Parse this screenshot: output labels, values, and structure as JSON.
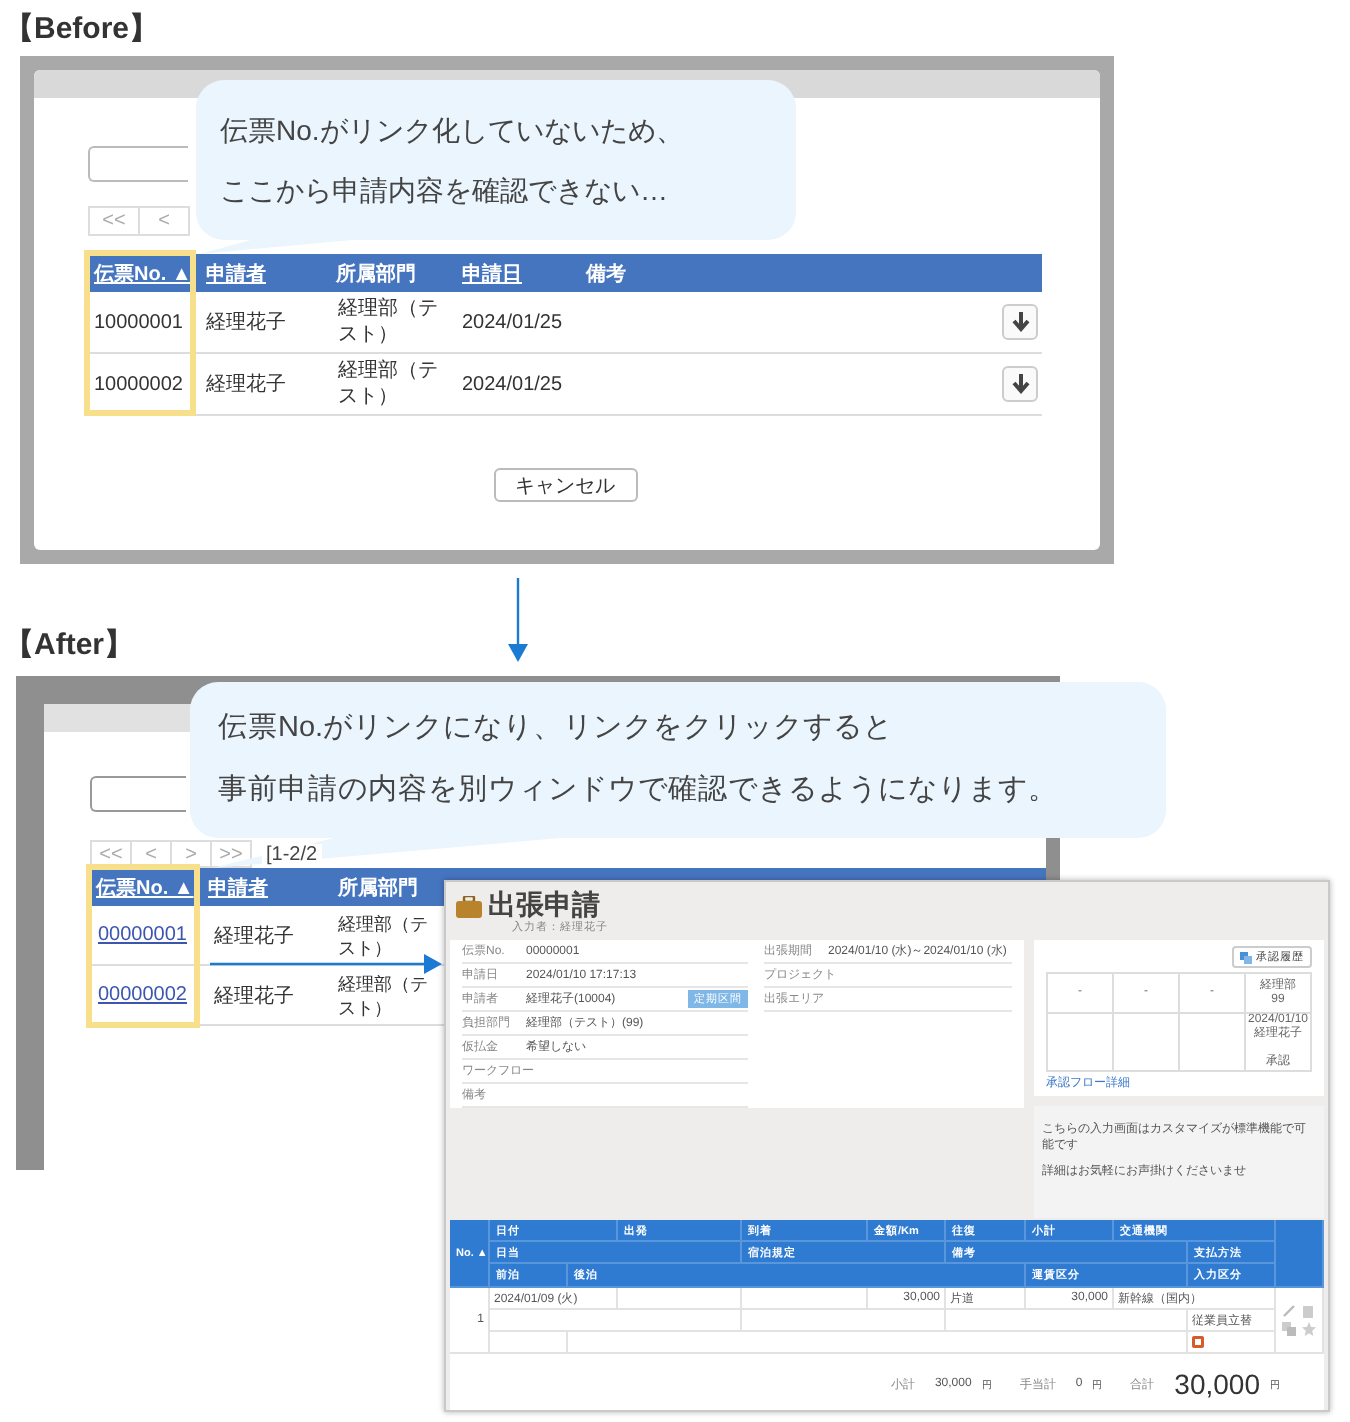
{
  "before": {
    "heading": "【Before】",
    "callout": [
      "伝票No.がリンク化していないため、",
      "ここから申請内容を確認できない…"
    ],
    "pager": [
      "<<",
      "<"
    ],
    "columns": [
      {
        "label": "伝票No. ▲",
        "sortable": true
      },
      {
        "label": "申請者",
        "sortable": true
      },
      {
        "label": "所属部門",
        "sortable": false
      },
      {
        "label": "申請日",
        "sortable": true
      },
      {
        "label": "備考",
        "sortable": false
      }
    ],
    "rows": [
      {
        "number": "10000001",
        "applicant": "経理花子",
        "department": "経理部（テスト）",
        "date": "2024/01/25"
      },
      {
        "number": "10000002",
        "applicant": "経理花子",
        "department": "経理部（テスト）",
        "date": "2024/01/25"
      }
    ],
    "cancel_button": "キャンセル"
  },
  "after": {
    "heading": "【After】",
    "callout": [
      "伝票No.がリンクになり、リンクをクリックすると",
      "事前申請の内容を別ウィンドウで確認できるようになります。"
    ],
    "pager": [
      "<<",
      "<",
      ">",
      ">>"
    ],
    "page_info": "[1-2/2",
    "columns": [
      {
        "label": "伝票No. ▲",
        "sortable": true
      },
      {
        "label": "申請者",
        "sortable": true
      },
      {
        "label": "所属部門",
        "sortable": false
      }
    ],
    "rows": [
      {
        "number": "00000001",
        "applicant": "経理花子",
        "department": "経理部（テスト）"
      },
      {
        "number": "00000002",
        "applicant": "経理花子",
        "department": "経理部（テスト）"
      }
    ]
  },
  "detail_window": {
    "title": "出張申請",
    "author": "入力者：経理花子",
    "fields": [
      {
        "label": "伝票No.",
        "value": "00000001"
      },
      {
        "label": "申請日",
        "value": "2024/01/10 17:17:13"
      },
      {
        "label": "申請者",
        "value": "経理花子(10004)",
        "button": "定期区間"
      },
      {
        "label": "負担部門",
        "value": "経理部（テスト）(99)"
      },
      {
        "label": "仮払金",
        "value": "希望しない"
      },
      {
        "label": "ワークフロー"
      },
      {
        "label": "備考"
      }
    ],
    "trip_fields": [
      {
        "label": "出張期間",
        "value": "2024/01/10 (水)～2024/01/10 (水)"
      },
      {
        "label": "プロジェクト"
      },
      {
        "label": "出張エリア"
      }
    ],
    "history_button": "承認履歴",
    "approval_steps": [
      {
        "lines": [
          "-"
        ]
      },
      {
        "lines": [
          "-"
        ]
      },
      {
        "lines": [
          "-"
        ]
      },
      {
        "lines": [
          "経理部",
          "99"
        ],
        "result_lines": [
          "2024/01/10",
          "経理花子"
        ],
        "status": "承認"
      }
    ],
    "flow_link": "承認フロー詳細",
    "notes": [
      "こちらの入力画面はカスタマイズが標準機能で可能です",
      "詳細はお気軽にお声掛けくださいませ"
    ],
    "table": {
      "no_header": "No. ▲",
      "header_rows": [
        [
          "日付",
          "出発",
          "到着",
          "金額/Km",
          "往復",
          "小計",
          "交通機関"
        ],
        [
          "日当",
          "宿泊規定",
          "備考",
          "支払方法"
        ],
        [
          "前泊",
          "後泊",
          "運賃区分",
          "入力区分"
        ]
      ],
      "rows": [
        {
          "no": "1",
          "date": "2024/01/09 (火)",
          "amount": "30,000",
          "trip": "片道",
          "subtotal": "30,000",
          "transport": "新幹線（国内）",
          "payment": "従業員立替"
        }
      ]
    },
    "totals": [
      {
        "kind": "sub",
        "label": "小計",
        "value": "30,000",
        "unit": "円"
      },
      {
        "kind": "sub",
        "label": "手当計",
        "value": "0",
        "unit": "円"
      },
      {
        "kind": "grand",
        "label": "合計",
        "value": "30,000",
        "unit": "円"
      }
    ]
  }
}
